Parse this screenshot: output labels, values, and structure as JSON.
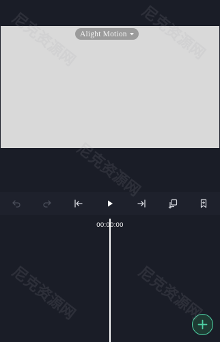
{
  "preview": {
    "watermark_label": "Alight Motion"
  },
  "toolbar": {
    "buttons": [
      {
        "name": "undo-button",
        "icon": "undo-icon",
        "enabled": false
      },
      {
        "name": "redo-button",
        "icon": "redo-icon",
        "enabled": false
      },
      {
        "name": "jump-to-start-button",
        "icon": "skip-to-start-icon",
        "enabled": true
      },
      {
        "name": "play-button",
        "icon": "play-icon",
        "enabled": true
      },
      {
        "name": "jump-to-end-button",
        "icon": "skip-to-end-icon",
        "enabled": true
      },
      {
        "name": "clip-button",
        "icon": "copy-plus-icon",
        "enabled": true
      },
      {
        "name": "bookmark-button",
        "icon": "bookmark-icon",
        "enabled": true
      }
    ]
  },
  "timeline": {
    "timecode": "00:00:00"
  },
  "add_button": {
    "icon": "plus-icon"
  },
  "overlay_watermark": {
    "text": "尼克资源网"
  },
  "colors": {
    "background": "#1a1d27",
    "toolbar": "#1e212c",
    "preview": "#d9d9d9",
    "accent": "#4fd1a5"
  }
}
